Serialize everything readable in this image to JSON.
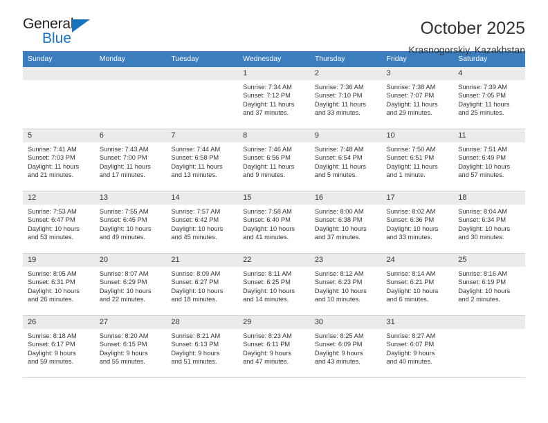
{
  "logo": {
    "word_one": "General",
    "word_two": "Blue",
    "triangle_icon": "triangle-icon",
    "accent_color": "#1a74bb"
  },
  "header": {
    "title": "October 2025",
    "subtitle": "Krasnogorskiy, Kazakhstan"
  },
  "calendar": {
    "header_bg": "#3b7dbd",
    "date_band_bg": "#ebebeb",
    "weekday_headers": [
      "Sunday",
      "Monday",
      "Tuesday",
      "Wednesday",
      "Thursday",
      "Friday",
      "Saturday"
    ],
    "weeks": [
      [
        {
          "day": "",
          "lines": []
        },
        {
          "day": "",
          "lines": []
        },
        {
          "day": "",
          "lines": []
        },
        {
          "day": "1",
          "lines": [
            "Sunrise: 7:34 AM",
            "Sunset: 7:12 PM",
            "Daylight: 11 hours",
            "and 37 minutes."
          ]
        },
        {
          "day": "2",
          "lines": [
            "Sunrise: 7:36 AM",
            "Sunset: 7:10 PM",
            "Daylight: 11 hours",
            "and 33 minutes."
          ]
        },
        {
          "day": "3",
          "lines": [
            "Sunrise: 7:38 AM",
            "Sunset: 7:07 PM",
            "Daylight: 11 hours",
            "and 29 minutes."
          ]
        },
        {
          "day": "4",
          "lines": [
            "Sunrise: 7:39 AM",
            "Sunset: 7:05 PM",
            "Daylight: 11 hours",
            "and 25 minutes."
          ]
        }
      ],
      [
        {
          "day": "5",
          "lines": [
            "Sunrise: 7:41 AM",
            "Sunset: 7:03 PM",
            "Daylight: 11 hours",
            "and 21 minutes."
          ]
        },
        {
          "day": "6",
          "lines": [
            "Sunrise: 7:43 AM",
            "Sunset: 7:00 PM",
            "Daylight: 11 hours",
            "and 17 minutes."
          ]
        },
        {
          "day": "7",
          "lines": [
            "Sunrise: 7:44 AM",
            "Sunset: 6:58 PM",
            "Daylight: 11 hours",
            "and 13 minutes."
          ]
        },
        {
          "day": "8",
          "lines": [
            "Sunrise: 7:46 AM",
            "Sunset: 6:56 PM",
            "Daylight: 11 hours",
            "and 9 minutes."
          ]
        },
        {
          "day": "9",
          "lines": [
            "Sunrise: 7:48 AM",
            "Sunset: 6:54 PM",
            "Daylight: 11 hours",
            "and 5 minutes."
          ]
        },
        {
          "day": "10",
          "lines": [
            "Sunrise: 7:50 AM",
            "Sunset: 6:51 PM",
            "Daylight: 11 hours",
            "and 1 minute."
          ]
        },
        {
          "day": "11",
          "lines": [
            "Sunrise: 7:51 AM",
            "Sunset: 6:49 PM",
            "Daylight: 10 hours",
            "and 57 minutes."
          ]
        }
      ],
      [
        {
          "day": "12",
          "lines": [
            "Sunrise: 7:53 AM",
            "Sunset: 6:47 PM",
            "Daylight: 10 hours",
            "and 53 minutes."
          ]
        },
        {
          "day": "13",
          "lines": [
            "Sunrise: 7:55 AM",
            "Sunset: 6:45 PM",
            "Daylight: 10 hours",
            "and 49 minutes."
          ]
        },
        {
          "day": "14",
          "lines": [
            "Sunrise: 7:57 AM",
            "Sunset: 6:42 PM",
            "Daylight: 10 hours",
            "and 45 minutes."
          ]
        },
        {
          "day": "15",
          "lines": [
            "Sunrise: 7:58 AM",
            "Sunset: 6:40 PM",
            "Daylight: 10 hours",
            "and 41 minutes."
          ]
        },
        {
          "day": "16",
          "lines": [
            "Sunrise: 8:00 AM",
            "Sunset: 6:38 PM",
            "Daylight: 10 hours",
            "and 37 minutes."
          ]
        },
        {
          "day": "17",
          "lines": [
            "Sunrise: 8:02 AM",
            "Sunset: 6:36 PM",
            "Daylight: 10 hours",
            "and 33 minutes."
          ]
        },
        {
          "day": "18",
          "lines": [
            "Sunrise: 8:04 AM",
            "Sunset: 6:34 PM",
            "Daylight: 10 hours",
            "and 30 minutes."
          ]
        }
      ],
      [
        {
          "day": "19",
          "lines": [
            "Sunrise: 8:05 AM",
            "Sunset: 6:31 PM",
            "Daylight: 10 hours",
            "and 26 minutes."
          ]
        },
        {
          "day": "20",
          "lines": [
            "Sunrise: 8:07 AM",
            "Sunset: 6:29 PM",
            "Daylight: 10 hours",
            "and 22 minutes."
          ]
        },
        {
          "day": "21",
          "lines": [
            "Sunrise: 8:09 AM",
            "Sunset: 6:27 PM",
            "Daylight: 10 hours",
            "and 18 minutes."
          ]
        },
        {
          "day": "22",
          "lines": [
            "Sunrise: 8:11 AM",
            "Sunset: 6:25 PM",
            "Daylight: 10 hours",
            "and 14 minutes."
          ]
        },
        {
          "day": "23",
          "lines": [
            "Sunrise: 8:12 AM",
            "Sunset: 6:23 PM",
            "Daylight: 10 hours",
            "and 10 minutes."
          ]
        },
        {
          "day": "24",
          "lines": [
            "Sunrise: 8:14 AM",
            "Sunset: 6:21 PM",
            "Daylight: 10 hours",
            "and 6 minutes."
          ]
        },
        {
          "day": "25",
          "lines": [
            "Sunrise: 8:16 AM",
            "Sunset: 6:19 PM",
            "Daylight: 10 hours",
            "and 2 minutes."
          ]
        }
      ],
      [
        {
          "day": "26",
          "lines": [
            "Sunrise: 8:18 AM",
            "Sunset: 6:17 PM",
            "Daylight: 9 hours",
            "and 59 minutes."
          ]
        },
        {
          "day": "27",
          "lines": [
            "Sunrise: 8:20 AM",
            "Sunset: 6:15 PM",
            "Daylight: 9 hours",
            "and 55 minutes."
          ]
        },
        {
          "day": "28",
          "lines": [
            "Sunrise: 8:21 AM",
            "Sunset: 6:13 PM",
            "Daylight: 9 hours",
            "and 51 minutes."
          ]
        },
        {
          "day": "29",
          "lines": [
            "Sunrise: 8:23 AM",
            "Sunset: 6:11 PM",
            "Daylight: 9 hours",
            "and 47 minutes."
          ]
        },
        {
          "day": "30",
          "lines": [
            "Sunrise: 8:25 AM",
            "Sunset: 6:09 PM",
            "Daylight: 9 hours",
            "and 43 minutes."
          ]
        },
        {
          "day": "31",
          "lines": [
            "Sunrise: 8:27 AM",
            "Sunset: 6:07 PM",
            "Daylight: 9 hours",
            "and 40 minutes."
          ]
        },
        {
          "day": "",
          "lines": []
        }
      ]
    ]
  }
}
